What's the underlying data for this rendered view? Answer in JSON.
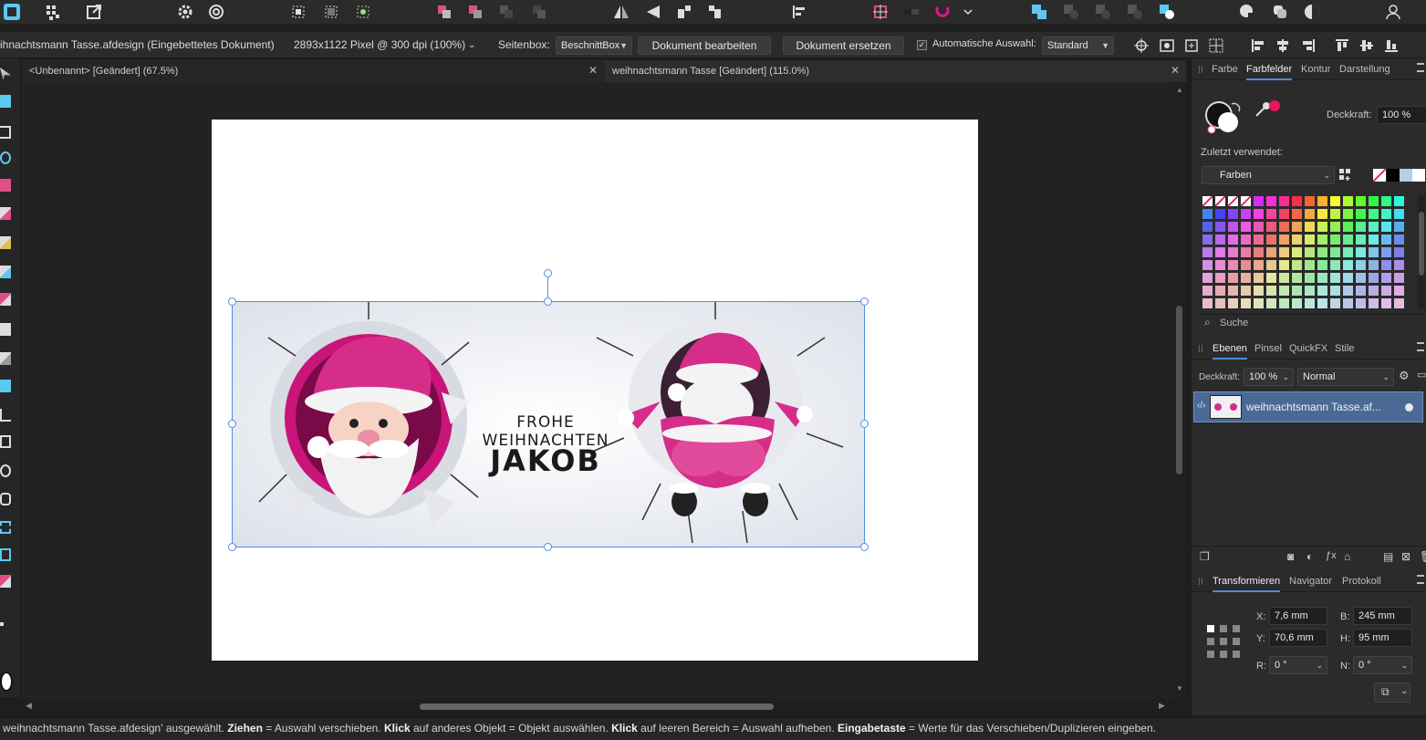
{
  "context_bar": {
    "document_name": "ihnachtsmann Tasse.afdesign (Eingebettetes Dokument)",
    "dimensions": "2893x1122 Pixel @ 300 dpi (100%)",
    "pagebox_label": "Seitenbox:",
    "pagebox_value": "BeschnittBox",
    "edit_document_button": "Dokument bearbeiten",
    "replace_document_button": "Dokument ersetzen",
    "auto_select_label": "Automatische Auswahl:",
    "auto_select_value": "Standard"
  },
  "tabs": [
    {
      "label": "<Unbenannt> [Geändert] (67.5%)"
    },
    {
      "label": "weihnachtsmann Tasse [Geändert] (115.0%)"
    }
  ],
  "artwork": {
    "line1": "FROHE WEIHNACHTEN",
    "line2": "JAKOB"
  },
  "color_panel": {
    "tabs": [
      "Farbe",
      "Farbfelder",
      "Kontur",
      "Darstellung"
    ],
    "active_tab": "Farbfelder",
    "opacity_label": "Deckkraft:",
    "opacity_value": "100 %",
    "recent_label": "Zuletzt verwendet:",
    "palette_value": "Farben",
    "search_placeholder": "Suche",
    "accent_color": "#e8185a"
  },
  "layers_panel": {
    "tabs": [
      "Ebenen",
      "Pinsel",
      "QuickFX",
      "Stile"
    ],
    "active_tab": "Ebenen",
    "opacity_label": "Deckkraft:",
    "opacity_value": "100 %",
    "blend_mode": "Normal",
    "layers": [
      {
        "name": "weihnachtsmann Tasse.af..."
      }
    ]
  },
  "transform_panel": {
    "tabs": [
      "Transformieren",
      "Navigator",
      "Protokoll"
    ],
    "active_tab": "Transformieren",
    "x_label": "X:",
    "x_value": "7,6 mm",
    "y_label": "Y:",
    "y_value": "70,6 mm",
    "w_label": "B:",
    "w_value": "245 mm",
    "h_label": "H:",
    "h_value": "95 mm",
    "r_label": "R:",
    "r_value": "0 °",
    "s_label": "N:",
    "s_value": "0 °"
  },
  "status_bar": {
    "part1": "weihnachtsmann Tasse.afdesign' ausgewählt. ",
    "b1": "Ziehen",
    "part2": " = Auswahl verschieben. ",
    "b2": "Klick",
    "part3": " auf anderes Objekt = Objekt auswählen. ",
    "b3": "Klick",
    "part4": " auf leeren Bereich = Auswahl aufheben. ",
    "b4": "Eingabetaste",
    "part5": " = Werte für das Verschieben/Duplizieren eingeben."
  }
}
